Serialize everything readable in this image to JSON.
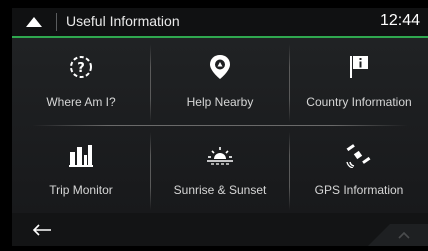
{
  "header": {
    "title": "Useful Information",
    "clock": "12:44"
  },
  "tiles": [
    {
      "label": "Where Am I?",
      "icon": "location-question-icon"
    },
    {
      "label": "Help Nearby",
      "icon": "help-pin-icon"
    },
    {
      "label": "Country Information",
      "icon": "info-flag-icon"
    },
    {
      "label": "Trip Monitor",
      "icon": "bar-chart-icon"
    },
    {
      "label": "Sunrise & Sunset",
      "icon": "sunrise-icon"
    },
    {
      "label": "GPS Information",
      "icon": "satellite-icon"
    }
  ],
  "bottom_bar": {
    "back_icon": "arrow-left-icon",
    "up_icon": "chevron-up-icon"
  },
  "colors": {
    "accent": "#2fa84f",
    "background": "#000000",
    "panel": "#1d1f21"
  }
}
